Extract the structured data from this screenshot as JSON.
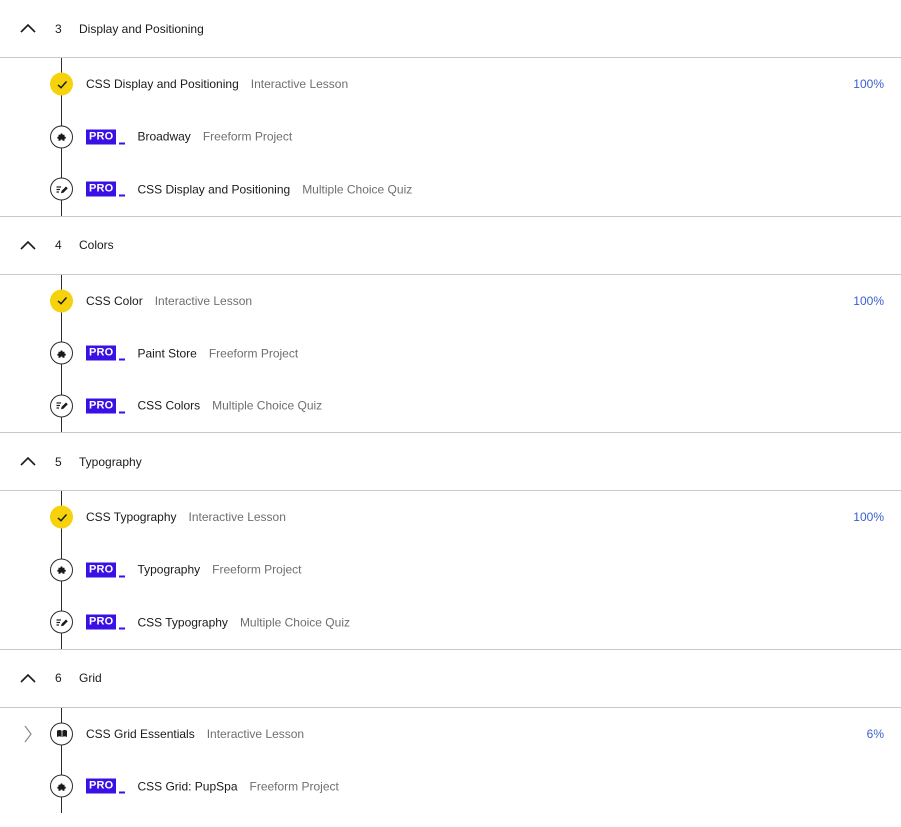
{
  "icons": {
    "caret_up": "chevron-up-icon",
    "chevron_right": "chevron-right-icon",
    "check": "check-icon",
    "puzzle": "puzzle-icon",
    "quiz": "quiz-icon",
    "book": "book-icon"
  },
  "colors": {
    "pro_badge": "#3a10e5",
    "complete": "#f5d20b",
    "percent": "#3a5fcd"
  },
  "sections": [
    {
      "number": "3",
      "title": "Display and Positioning",
      "items": [
        {
          "pro": false,
          "badge": "",
          "title": "CSS Display and Positioning",
          "type": "Interactive Lesson",
          "percent": "100%",
          "status": "complete"
        },
        {
          "pro": true,
          "badge": "PRO",
          "title": "Broadway",
          "type": "Freeform Project",
          "percent": "",
          "status": "project"
        },
        {
          "pro": true,
          "badge": "PRO",
          "title": "CSS Display and Positioning",
          "type": "Multiple Choice Quiz",
          "percent": "",
          "status": "quiz"
        }
      ]
    },
    {
      "number": "4",
      "title": "Colors",
      "items": [
        {
          "pro": false,
          "badge": "",
          "title": "CSS Color",
          "type": "Interactive Lesson",
          "percent": "100%",
          "status": "complete"
        },
        {
          "pro": true,
          "badge": "PRO",
          "title": "Paint Store",
          "type": "Freeform Project",
          "percent": "",
          "status": "project"
        },
        {
          "pro": true,
          "badge": "PRO",
          "title": "CSS Colors",
          "type": "Multiple Choice Quiz",
          "percent": "",
          "status": "quiz"
        }
      ]
    },
    {
      "number": "5",
      "title": "Typography",
      "items": [
        {
          "pro": false,
          "badge": "",
          "title": "CSS Typography",
          "type": "Interactive Lesson",
          "percent": "100%",
          "status": "complete"
        },
        {
          "pro": true,
          "badge": "PRO",
          "title": "Typography",
          "type": "Freeform Project",
          "percent": "",
          "status": "project"
        },
        {
          "pro": true,
          "badge": "PRO",
          "title": "CSS Typography",
          "type": "Multiple Choice Quiz",
          "percent": "",
          "status": "quiz"
        }
      ]
    },
    {
      "number": "6",
      "title": "Grid",
      "items": [
        {
          "pro": false,
          "badge": "",
          "title": "CSS Grid Essentials",
          "type": "Interactive Lesson",
          "percent": "6%",
          "status": "current"
        },
        {
          "pro": true,
          "badge": "PRO",
          "title": "CSS Grid: PupSpa",
          "type": "Freeform Project",
          "percent": "",
          "status": "project"
        }
      ]
    }
  ]
}
